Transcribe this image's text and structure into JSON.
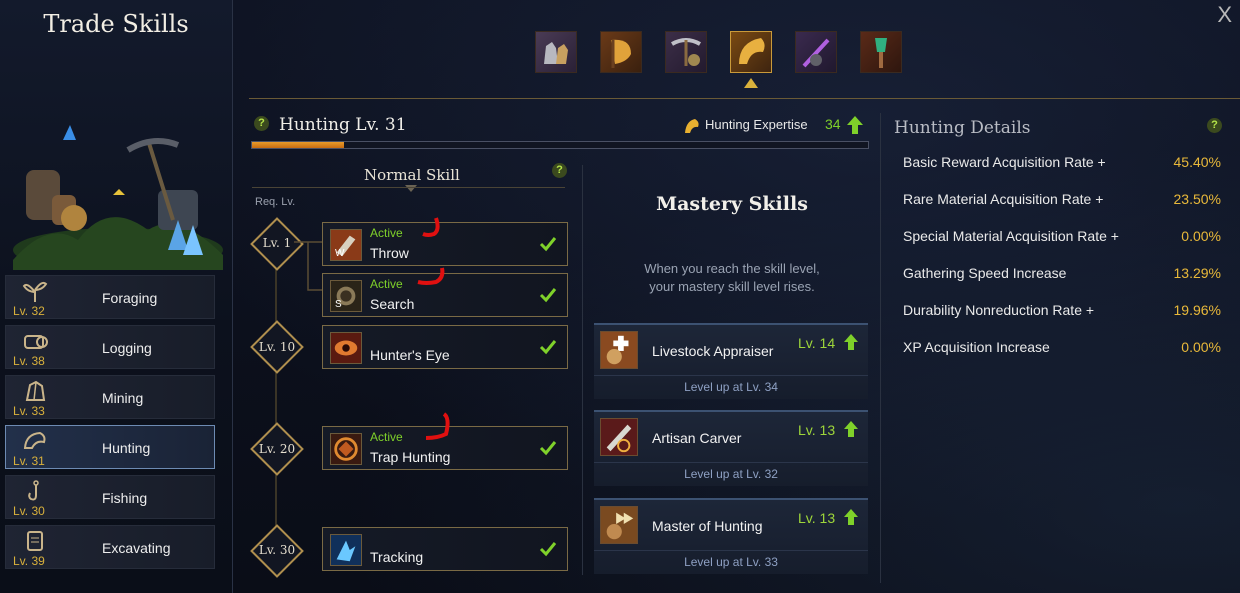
{
  "window": {
    "title": "Trade Skills",
    "close_label": "X"
  },
  "categories": [
    {
      "name": "Foraging",
      "level": "Lv. 32",
      "icon": "sprout-icon"
    },
    {
      "name": "Logging",
      "level": "Lv. 38",
      "icon": "log-icon"
    },
    {
      "name": "Mining",
      "level": "Lv. 33",
      "icon": "ore-icon"
    },
    {
      "name": "Hunting",
      "level": "Lv. 31",
      "icon": "horn-icon",
      "selected": true
    },
    {
      "name": "Fishing",
      "level": "Lv. 30",
      "icon": "fishhook-icon"
    },
    {
      "name": "Excavating",
      "level": "Lv. 39",
      "icon": "scroll-icon"
    }
  ],
  "tabs": [
    {
      "name": "gloves-tab",
      "icon": "gloves-icon"
    },
    {
      "name": "axe-tab",
      "icon": "axe-icon"
    },
    {
      "name": "pickaxe-tab",
      "icon": "pickaxe-icon"
    },
    {
      "name": "hunting-tab",
      "icon": "horn-icon",
      "selected": true
    },
    {
      "name": "fishing-tab",
      "icon": "rod-icon"
    },
    {
      "name": "shovel-tab",
      "icon": "shovel-icon"
    }
  ],
  "header": {
    "help": "?",
    "title": "Hunting Lv. 31",
    "expertise_label": "Hunting Expertise",
    "expertise_value": "34",
    "progress": 0.15
  },
  "normal_skill": {
    "title": "Normal Skill",
    "help": "?",
    "req_label": "Req. Lv.",
    "levels": [
      "Lv. 1",
      "Lv. 10",
      "Lv. 20",
      "Lv. 30"
    ],
    "skills": [
      {
        "name": "Throw",
        "status": "Active",
        "key": "W"
      },
      {
        "name": "Search",
        "status": "Active",
        "key": "S"
      },
      {
        "name": "Hunter's Eye",
        "status": ""
      },
      {
        "name": "Trap Hunting",
        "status": "Active"
      },
      {
        "name": "Tracking",
        "status": ""
      }
    ]
  },
  "mastery": {
    "title": "Mastery Skills",
    "desc_line1": "When you reach the skill level,",
    "desc_line2": "your mastery skill level rises.",
    "skills": [
      {
        "name": "Livestock Appraiser",
        "level": "Lv. 14",
        "hint": "Level up at Lv. 34"
      },
      {
        "name": "Artisan Carver",
        "level": "Lv. 13",
        "hint": "Level up at Lv. 32"
      },
      {
        "name": "Master of Hunting",
        "level": "Lv. 13",
        "hint": "Level up at Lv. 33"
      }
    ]
  },
  "details": {
    "title": "Hunting Details",
    "help": "?",
    "rows": [
      {
        "label": "Basic Reward Acquisition Rate +",
        "value": "45.40%"
      },
      {
        "label": "Rare Material Acquisition Rate +",
        "value": "23.50%"
      },
      {
        "label": "Special Material Acquisition Rate +",
        "value": "0.00%"
      },
      {
        "label": "Gathering Speed Increase",
        "value": "13.29%"
      },
      {
        "label": "Durability Nonreduction Rate +",
        "value": "19.96%"
      },
      {
        "label": "XP Acquisition Increase",
        "value": "0.00%"
      }
    ]
  },
  "colors": {
    "accent_gold": "#d9b13c",
    "active_green": "#7fd12a",
    "progress_orange": "#e99b2a"
  }
}
